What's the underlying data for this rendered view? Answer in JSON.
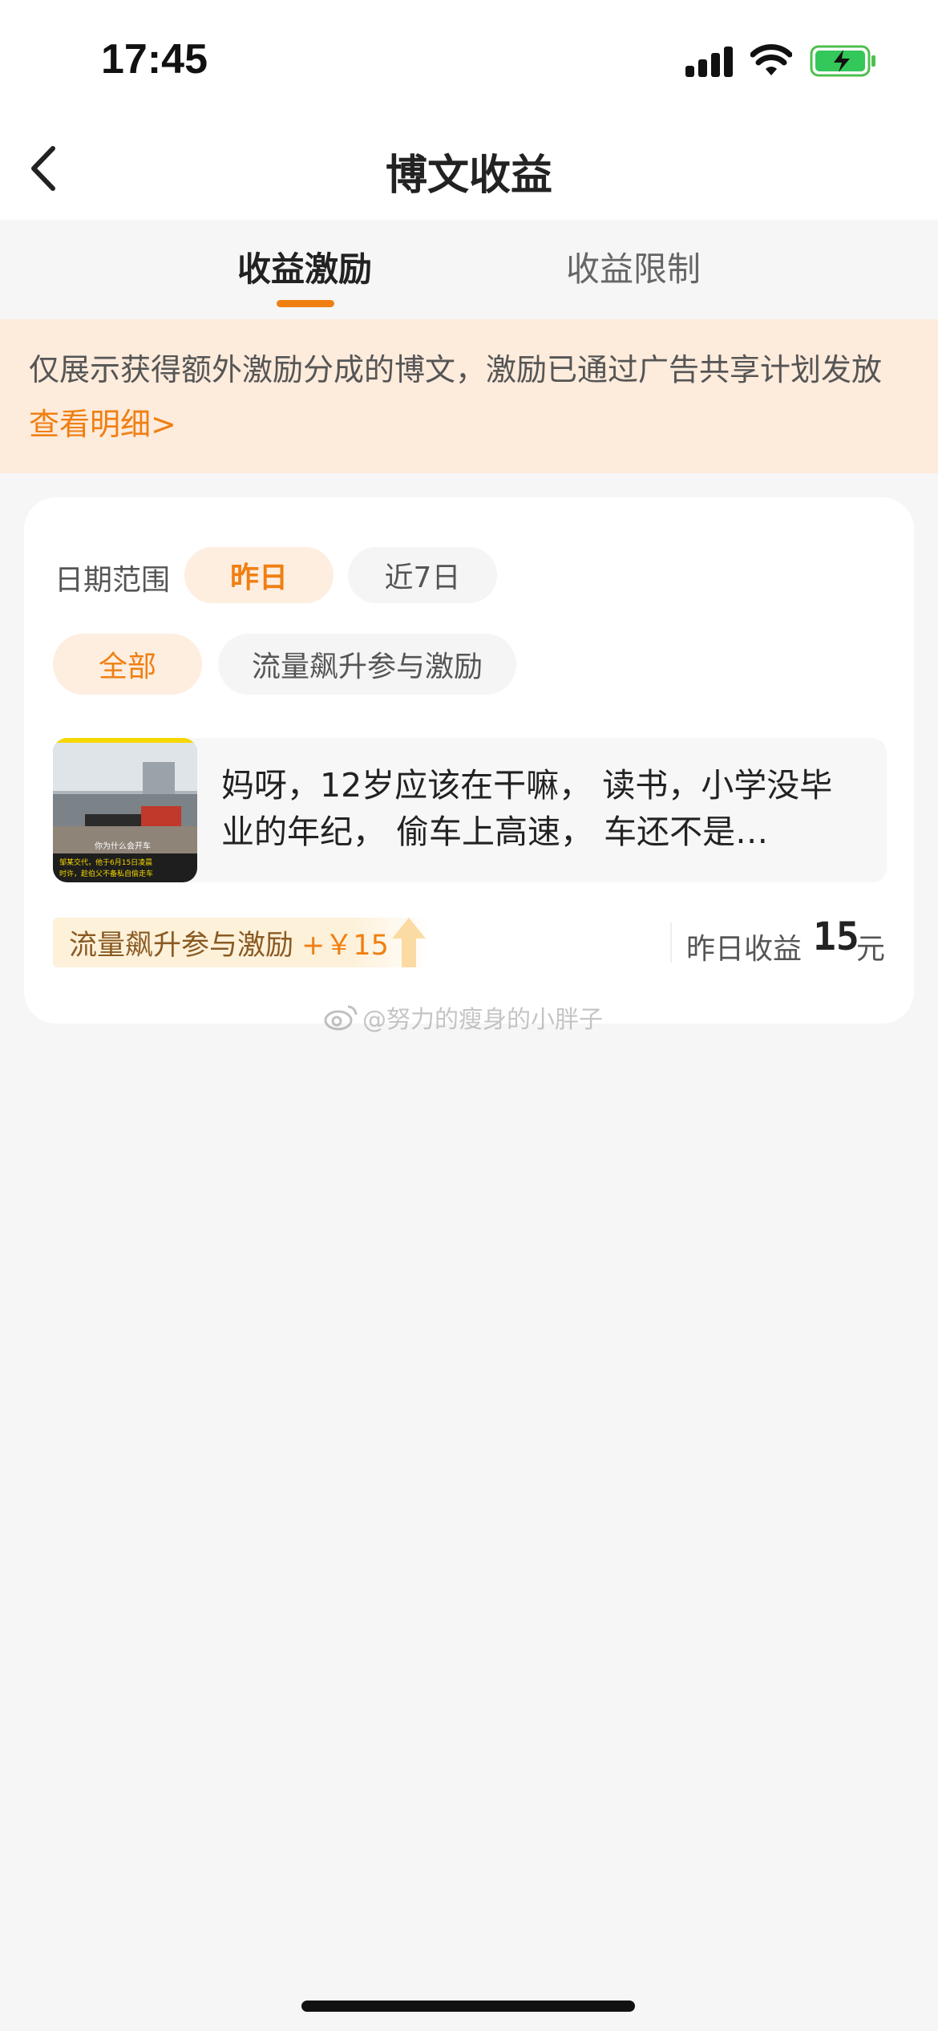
{
  "status_bar": {
    "time": "17:45"
  },
  "nav": {
    "title": "博文收益"
  },
  "tabs": [
    {
      "label": "收益激励",
      "active": true
    },
    {
      "label": "收益限制",
      "active": false
    }
  ],
  "notice": {
    "text": "仅展示获得额外激励分成的博文，激励已通过广告共享计划发放",
    "link": "查看明细>"
  },
  "filters": {
    "date_label": "日期范围",
    "date_options": [
      "昨日",
      "近7日"
    ],
    "date_selected": "昨日",
    "type_options": [
      "全部",
      "流量飙升参与激励"
    ],
    "type_selected": "全部"
  },
  "post": {
    "text": "妈呀，12岁应该在干嘛， 读书，小学没毕业的年纪， 偷车上高速， 车还不是…",
    "thumb_caption": "你为什么会开车",
    "thumb_subtitle_1": "邹某交代，他于6月15日凌晨",
    "thumb_subtitle_2": "时许，趁伯父不备私自偷走车"
  },
  "reward": {
    "label": "流量飙升参与激励",
    "amount": "+￥15"
  },
  "earnings": {
    "label": "昨日收益",
    "value": "15",
    "unit": "元"
  },
  "watermark": "@努力的瘦身的小胖子",
  "colors": {
    "accent": "#f07f12",
    "notice_bg": "#fdebdc"
  }
}
